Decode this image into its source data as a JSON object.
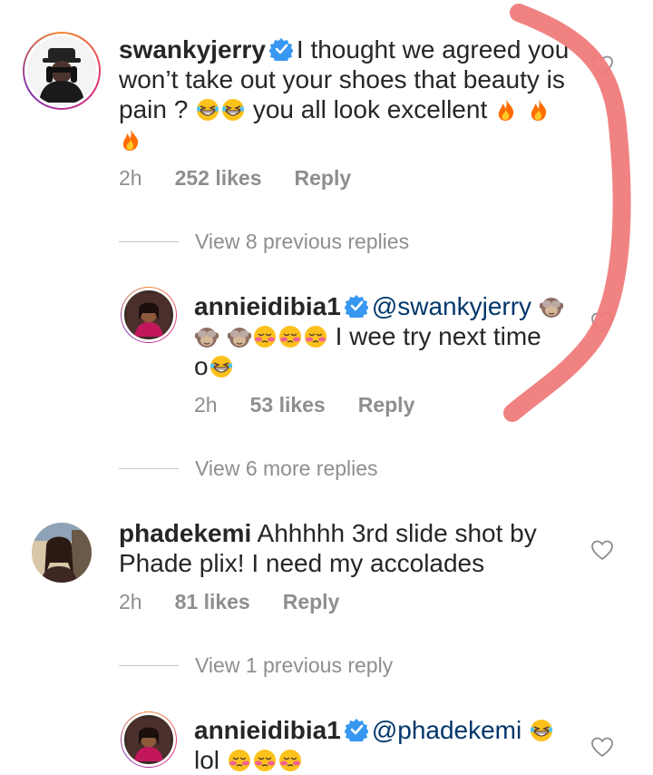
{
  "comments": [
    {
      "username": "swankyjerry",
      "verified": true,
      "text_line1": "I thought we agreed you",
      "text_line2": "won’t take out your shoes that beauty is",
      "text_line3a": "pain ?",
      "text_line3b": "you all look excellent",
      "time": "2h",
      "likes": "252 likes",
      "reply": "Reply"
    },
    {
      "username": "annieidibia1",
      "verified": true,
      "mention": "@swankyjerry",
      "text_line2": "I wee try next time",
      "text_line3": "o",
      "time": "2h",
      "likes": "53 likes",
      "reply": "Reply"
    },
    {
      "username": "phadekemi",
      "verified": false,
      "text_line1": "Ahhhhh 3rd slide shot by",
      "text_line2": "Phade plix! I need my accolades",
      "time": "2h",
      "likes": "81 likes",
      "reply": "Reply"
    },
    {
      "username": "annieidibia1",
      "verified": true,
      "mention": "@phadekemi",
      "text_line2": "lol"
    }
  ],
  "view_replies": [
    "View 8 previous replies",
    "View 6 more replies",
    "View 1 previous reply"
  ],
  "icons": {
    "heart": "heart-outline-icon",
    "verified": "verified-badge-icon",
    "laugh": "grinning-squinting-face-emoji",
    "fire": "fire-emoji",
    "monkey": "see-no-evil-monkey-emoji",
    "blush": "embarrassed-face-emoji"
  },
  "colors": {
    "text": "#262626",
    "secondary": "#8e8e8e",
    "mention": "#00376b",
    "verified": "#3897f0",
    "annotation": "#f07b7b"
  }
}
